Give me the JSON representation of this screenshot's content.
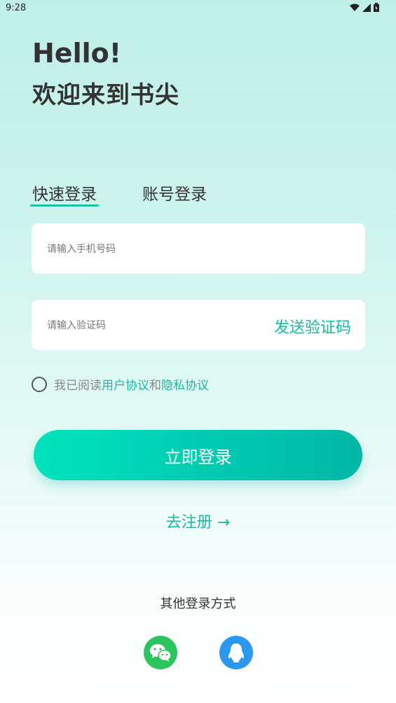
{
  "status_bar": {
    "time": "9:28"
  },
  "greeting": {
    "line1": "Hello!",
    "line2": "欢迎来到书尖"
  },
  "tabs": [
    {
      "label": "快速登录",
      "active": true
    },
    {
      "label": "账号登录",
      "active": false
    }
  ],
  "form": {
    "phone_placeholder": "请输入手机号码",
    "code_placeholder": "请输入验证码",
    "send_code_label": "发送验证码"
  },
  "agreement": {
    "prefix": "我已阅读",
    "user_agreement": "用户协议",
    "and": "和",
    "privacy_policy": "隐私协议"
  },
  "login_button": "立即登录",
  "register_link": "去注册 →",
  "other_login_label": "其他登录方式",
  "social": [
    {
      "icon": "wechat-icon",
      "color": "#2cc45d"
    },
    {
      "icon": "qq-icon",
      "color": "#2b98f0"
    }
  ],
  "colors": {
    "accent": "#17b9a6",
    "button_start": "#00e3bd",
    "button_end": "#00b7a6"
  }
}
